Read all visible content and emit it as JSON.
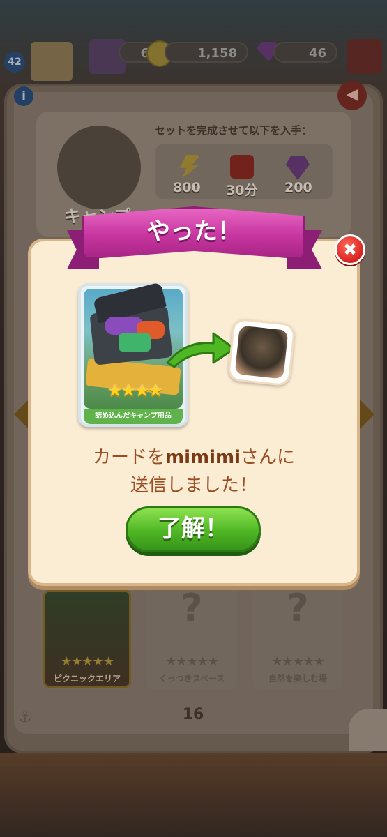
{
  "top_bar": {
    "level": "42",
    "star_partial": "6",
    "coins": "1,158",
    "gems": "46"
  },
  "album": {
    "set_reward_title": "セットを完成させて以下を入手：",
    "rewards": [
      {
        "icon": "lightning-icon",
        "value": "800"
      },
      {
        "icon": "mystery-box-icon",
        "value": "30分"
      },
      {
        "icon": "gem-icon",
        "value": "200"
      }
    ],
    "set_name_partial": "キャンプ",
    "slots": [
      {
        "label": "ピクニックエリア",
        "owned": true
      },
      {
        "label": "くっつきスペース",
        "owned": false
      },
      {
        "label": "自然を楽しむ場",
        "owned": false
      }
    ],
    "page_number": "16",
    "info_glyph": "i",
    "back_glyph": "◀",
    "unknown_glyph": "?",
    "stars_5": "★★★★★",
    "anchor_glyph": "⚓"
  },
  "dialog": {
    "title": "やった！",
    "close_glyph": "✖",
    "card_label": "詰め込んだキャンプ用品",
    "card_stars": "★★★★",
    "message_prefix": "カードを",
    "recipient": "mimimi",
    "message_suffix": "さんに",
    "message_line2": "送信しました！",
    "ok_label": "了解！"
  },
  "colors": {
    "ribbon": "#c7369f",
    "ok_button": "#4fb624",
    "close_button": "#d8221d",
    "dialog_bg": "#fbecd4",
    "message_text": "#9a4d22"
  }
}
